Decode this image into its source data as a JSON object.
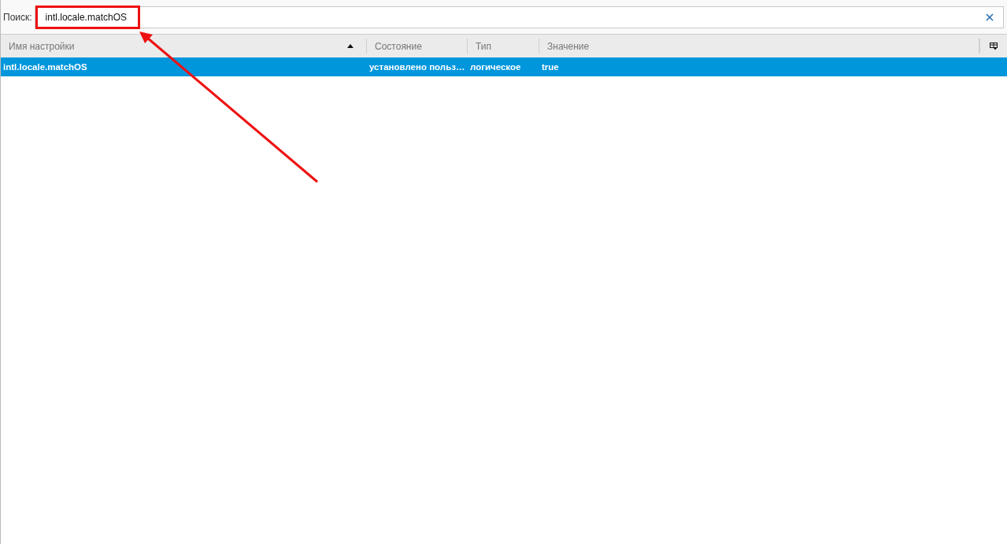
{
  "search": {
    "label": "Поиск:",
    "value": "intl.locale.matchOS"
  },
  "table": {
    "columns": [
      {
        "label": "Имя настройки",
        "sorted": true
      },
      {
        "label": "Состояние",
        "sorted": false
      },
      {
        "label": "Тип",
        "sorted": false
      },
      {
        "label": "Значение",
        "sorted": false
      }
    ],
    "rows": [
      {
        "cells": [
          "intl.locale.matchOS",
          "установлено польз…",
          "логическое",
          "true"
        ],
        "selected": true
      }
    ]
  }
}
